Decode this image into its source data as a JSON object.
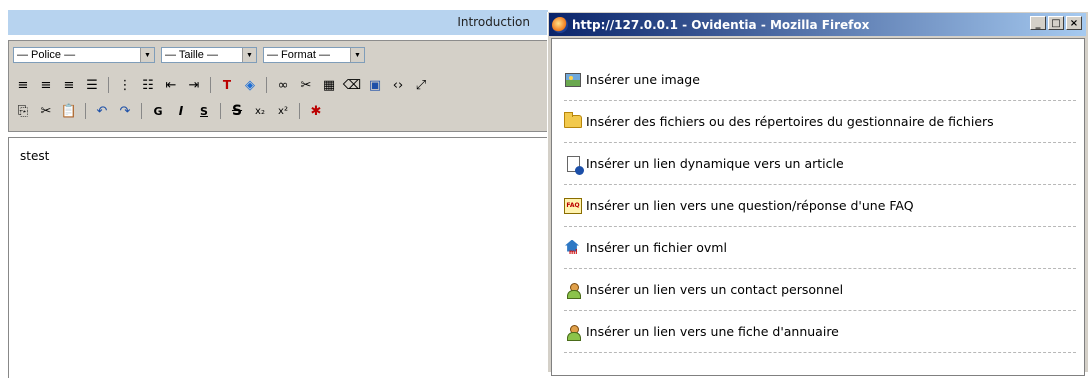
{
  "editor": {
    "header_title": "Introduction",
    "selects": {
      "police": "— Police —",
      "taille": "— Taille —",
      "format": "— Format —"
    },
    "content_text": "stest"
  },
  "popup": {
    "title": "http://127.0.0.1 - Ovidentia - Mozilla Firefox",
    "window_buttons": {
      "minimize": "_",
      "maximize": "□",
      "close": "×"
    },
    "items": [
      {
        "label": "Insérer une image",
        "icon": "image-icon"
      },
      {
        "label": "Insérer des fichiers ou des répertoires du gestionnaire de fichiers",
        "icon": "folder-icon"
      },
      {
        "label": "Insérer un lien dynamique vers un article",
        "icon": "article-link-icon"
      },
      {
        "label": "Insérer un lien vers une question/réponse d'une FAQ",
        "icon": "faq-icon"
      },
      {
        "label": "Insérer un fichier ovml",
        "icon": "ovml-icon"
      },
      {
        "label": "Insérer un lien vers un contact personnel",
        "icon": "contact-icon"
      },
      {
        "label": "Insérer un lien vers une fiche d'annuaire",
        "icon": "directory-icon"
      }
    ]
  },
  "toolbar": {
    "row1_icons": [
      "align-left-icon",
      "align-center-icon",
      "align-right-icon",
      "justify-icon",
      "ordered-list-icon",
      "unordered-list-icon",
      "outdent-icon",
      "indent-icon",
      "text-color-icon",
      "background-color-icon",
      "link-icon",
      "unlink-icon",
      "table-icon",
      "eraser-icon",
      "word-paste-icon",
      "source-code-icon",
      "fullscreen-icon"
    ],
    "row2_icons": [
      "copy-icon",
      "cut-icon",
      "paste-icon",
      "undo-icon",
      "redo-icon",
      "bold-icon",
      "italic-icon",
      "underline-icon",
      "strikethrough-icon",
      "subscript-icon",
      "superscript-icon",
      "ovidentia-plugin-icon"
    ],
    "bold_label": "G",
    "italic_label": "I",
    "underline_label": "S",
    "strike_label": "S",
    "sub_label": "x₂",
    "sup_label": "x²"
  }
}
